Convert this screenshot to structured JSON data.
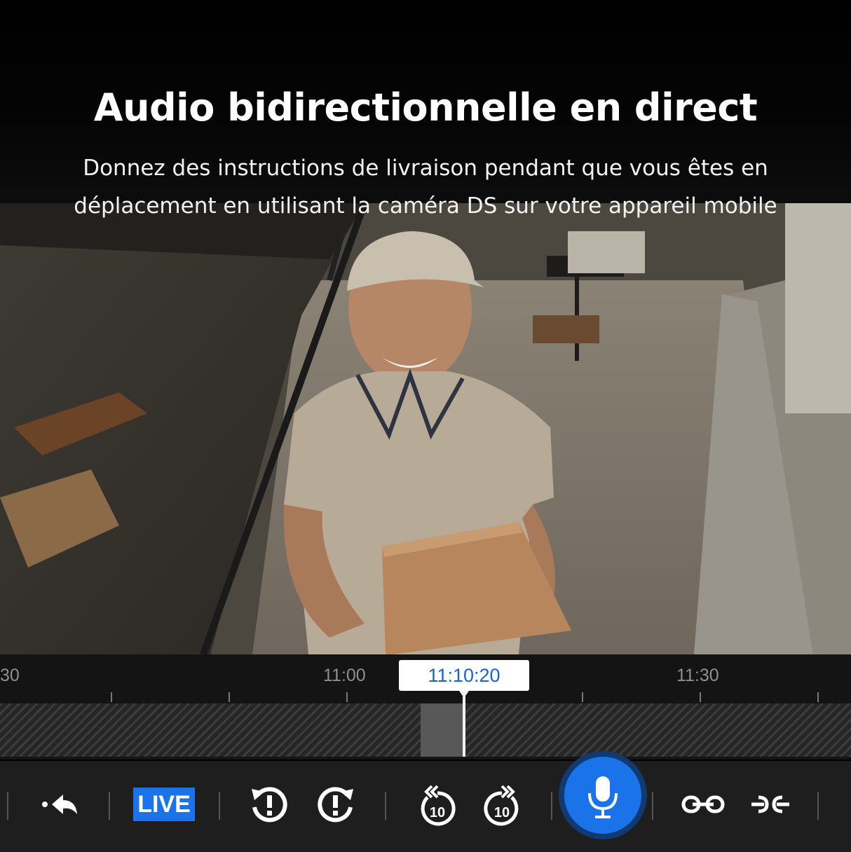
{
  "header": {
    "title": "Audio bidirectionnelle en direct",
    "subtitle": "Donnez des instructions de livraison pendant que vous êtes en déplacement en utilisant la caméra DS sur votre appareil mobile"
  },
  "video": {
    "description_icon": "camera-feed"
  },
  "timeline": {
    "labels": [
      "30",
      "11:00",
      "11:30"
    ],
    "current_time": "11:10:20"
  },
  "toolbar": {
    "live_label": "LIVE",
    "rewind_seconds": "10",
    "forward_seconds": "10",
    "icons": {
      "back": "back-arrow-icon",
      "replay_event": "replay-alert-icon",
      "forward_event": "forward-alert-icon",
      "rewind": "rewind-10-icon",
      "forward": "forward-10-icon",
      "mic": "microphone-icon",
      "expand": "expand-icon",
      "collapse": "collapse-icon"
    },
    "accent": "#1a73e8"
  }
}
